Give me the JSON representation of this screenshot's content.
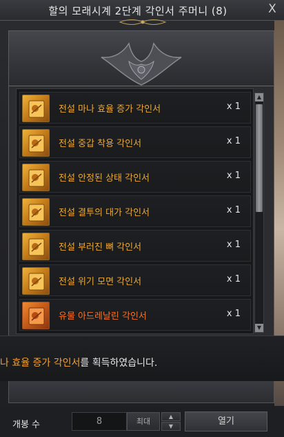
{
  "window": {
    "title": "할의 모래시계 2단계 각인서 주머니 (8)",
    "close_label": "X"
  },
  "items": [
    {
      "name": "전설 마나 효율 증가 각인서",
      "qty": "x 1",
      "grade": "legendary"
    },
    {
      "name": "전설 중갑 착용 각인서",
      "qty": "x 1",
      "grade": "legendary"
    },
    {
      "name": "전설 안정된 상태 각인서",
      "qty": "x 1",
      "grade": "legendary"
    },
    {
      "name": "전설 결투의 대가 각인서",
      "qty": "x 1",
      "grade": "legendary"
    },
    {
      "name": "전설 부러진 뼈 각인서",
      "qty": "x 1",
      "grade": "legendary"
    },
    {
      "name": "전설 위기 모면 각인서",
      "qty": "x 1",
      "grade": "legendary"
    },
    {
      "name": "유물 아드레날린 각인서",
      "qty": "x 1",
      "grade": "relic"
    }
  ],
  "message": {
    "highlight": "나 효율 증가 각인서",
    "rest": "를 획득하였습니다."
  },
  "footer": {
    "open_count_label": "개봉 수",
    "count_value": "8",
    "max_label": "최대",
    "open_label": "열기"
  },
  "colors": {
    "legendary": "#e8a83a",
    "relic": "#f0742a"
  }
}
